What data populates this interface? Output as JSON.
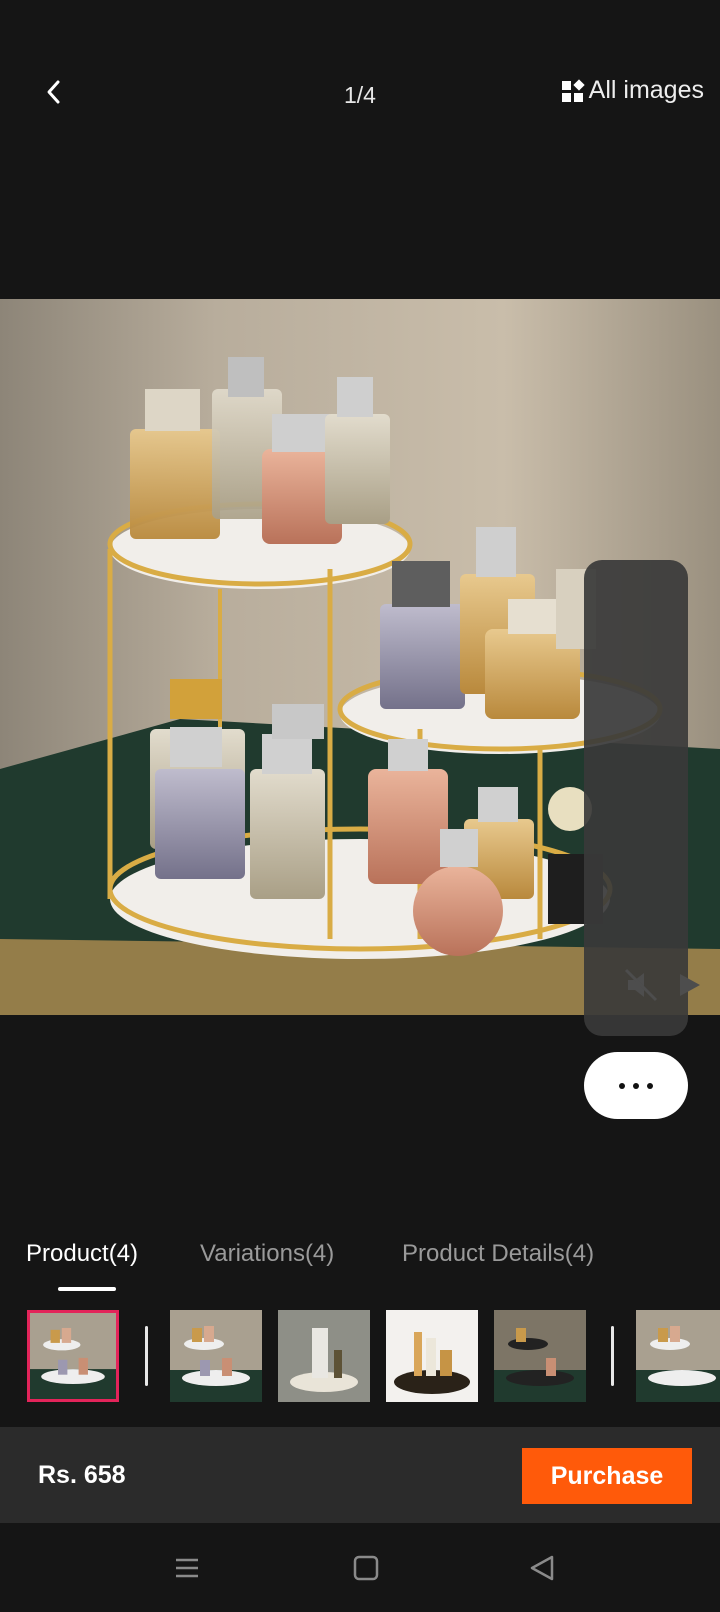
{
  "header": {
    "counter": "1/4",
    "all_images_label": "All images"
  },
  "tabs": [
    {
      "label": "Product(4)",
      "active": true
    },
    {
      "label": "Variations(4)",
      "active": false
    },
    {
      "label": "Product Details(4)",
      "active": false
    }
  ],
  "thumbnails_count": 7,
  "footer": {
    "price": "Rs. 658",
    "purchase_label": "Purchase"
  },
  "colors": {
    "accent": "#ff5a0a",
    "selected_border": "#e3245a",
    "background": "#151515"
  }
}
